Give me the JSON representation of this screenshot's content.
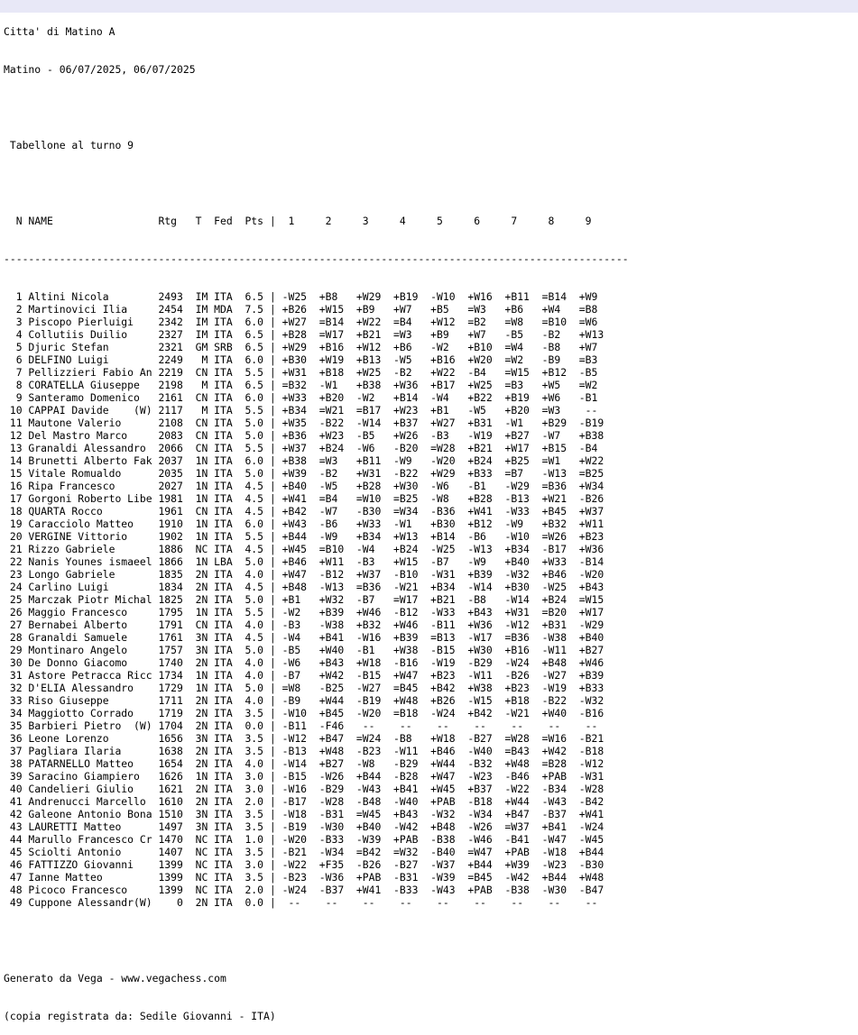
{
  "header": {
    "title": "Citta' di Matino A",
    "subtitle": "Matino - 06/07/2025, 06/07/2025",
    "board_title": " Tabellone al turno 9"
  },
  "table": {
    "columns_line": "  N NAME                 Rtg   T  Fed  Pts |  1     2     3     4     5     6     7     8     9",
    "separator_line": "-----------------------------------------------------------------------------------------------------",
    "rows": [
      "  1 Altini Nicola        2493  IM ITA  6.5 | -W25  +B8   +W29  +B19  -W10  +W16  +B11  =B14  +W9",
      "  2 Martinovici Ilia     2454  IM MDA  7.5 | +B26  +W15  +B9   +W7   +B5   =W3   +B6   +W4   =B8",
      "  3 Piscopo Pierluigi    2342  IM ITA  6.0 | +W27  =B14  +W22  =B4   +W12  =B2   =W8   =B10  =W6",
      "  4 Collutiis Duilio     2327  IM ITA  6.5 | +B28  =W17  +B21  =W3   +B9   +W7   -B5   -B2   +W13",
      "  5 Djuric Stefan        2321  GM SRB  6.5 | +W29  +B16  +W12  +B6   -W2   +B10  =W4   -B8   +W7",
      "  6 DELFINO Luigi        2249   M ITA  6.0 | +B30  +W19  +B13  -W5   +B16  +W20  =W2   -B9   =B3",
      "  7 Pellizzieri Fabio An 2219  CN ITA  5.5 | +W31  +B18  +W25  -B2   +W22  -B4   =W15  +B12  -B5",
      "  8 CORATELLA Giuseppe   2198   M ITA  6.5 | =B32  -W1   +B38  +W36  +B17  +W25  =B3   +W5   =W2",
      "  9 Santeramo Domenico   2161  CN ITA  6.0 | +W33  +B20  -W2   +B14  -W4   +B22  +B19  +W6   -B1",
      " 10 CAPPAI Davide    (W) 2117   M ITA  5.5 | +B34  =W21  =B17  +W23  +B1   -W5   +B20  =W3    --",
      " 11 Mautone Valerio      2108  CN ITA  5.0 | +W35  -B22  -W14  +B37  +W27  +B31  -W1   +B29  -B19",
      " 12 Del Mastro Marco     2083  CN ITA  5.0 | +B36  +W23  -B5   +W26  -B3   -W19  +B27  -W7   +B38",
      " 13 Granaldi Alessandro  2066  CN ITA  5.5 | +W37  +B24  -W6   -B20  =W28  +B21  +W17  +B15  -B4",
      " 14 Brunetti Alberto Fak 2037  1N ITA  6.0 | +B38  =W3   +B11  -W9   -W20  +B24  +B25  =W1   +W22",
      " 15 Vitale Romualdo      2035  1N ITA  5.0 | +W39  -B2   +W31  -B22  +W29  +B33  =B7   -W13  =B25",
      " 16 Ripa Francesco       2027  1N ITA  4.5 | +B40  -W5   +B28  +W30  -W6   -B1   -W29  =B36  +W34",
      " 17 Gorgoni Roberto Libe 1981  1N ITA  4.5 | +W41  =B4   =W10  =B25  -W8   +B28  -B13  +W21  -B26",
      " 18 QUARTA Rocco         1961  CN ITA  4.5 | +B42  -W7   -B30  =W34  -B36  +W41  -W33  +B45  +W37",
      " 19 Caracciolo Matteo    1910  1N ITA  6.0 | +W43  -B6   +W33  -W1   +B30  +B12  -W9   +B32  +W11",
      " 20 VERGINE Vittorio     1902  1N ITA  5.5 | +B44  -W9   +B34  +W13  +B14  -B6   -W10  =W26  +B23",
      " 21 Rizzo Gabriele       1886  NC ITA  4.5 | +W45  =B10  -W4   +B24  -W25  -W13  +B34  -B17  +W36",
      " 22 Nanis Younes ismaeel 1866  1N LBA  5.0 | +B46  +W11  -B3   +W15  -B7   -W9   +B40  +W33  -B14",
      " 23 Longo Gabriele       1835  2N ITA  4.0 | +W47  -B12  +W37  -B10  -W31  +B39  -W32  +B46  -W20",
      " 24 Carlino Luigi        1834  2N ITA  4.5 | +B48  -W13  =B36  -W21  +B34  -W14  +B30  -W25  +B43",
      " 25 Marczak Piotr Michal 1825  2N ITA  5.0 | +B1   +W32  -B7   =W17  +B21  -B8   -W14  +B24  =W15",
      " 26 Maggio Francesco     1795  1N ITA  5.5 | -W2   +B39  +W46  -B12  -W33  +B43  +W31  =B20  +W17",
      " 27 Bernabei Alberto     1791  CN ITA  4.0 | -B3   -W38  +B32  +W46  -B11  +W36  -W12  +B31  -W29",
      " 28 Granaldi Samuele     1761  3N ITA  4.5 | -W4   +B41  -W16  +B39  =B13  -W17  =B36  -W38  +B40",
      " 29 Montinaro Angelo     1757  3N ITA  5.0 | -B5   +W40  -B1   +W38  -B15  +W30  +B16  -W11  +B27",
      " 30 De Donno Giacomo     1740  2N ITA  4.0 | -W6   +B43  +W18  -B16  -W19  -B29  -W24  +B48  +W46",
      " 31 Astore Petracca Ricc 1734  1N ITA  4.0 | -B7   +W42  -B15  +W47  +B23  -W11  -B26  -W27  +B39",
      " 32 D'ELIA Alessandro    1729  1N ITA  5.0 | =W8   -B25  -W27  =B45  +B42  +W38  +B23  -W19  +B33",
      " 33 Riso Giuseppe        1711  2N ITA  4.0 | -B9   +W44  -B19  +W48  +B26  -W15  +B18  -B22  -W32",
      " 34 Maggiotto Corrado    1719  2N ITA  3.5 | -W10  +B45  -W20  =B18  -W24  +B42  -W21  +W40  -B16",
      " 35 Barbieri Pietro  (W) 1704  2N ITA  0.0 | -B11  -F46   --    --    --    --    --    --    --",
      " 36 Leone Lorenzo        1656  3N ITA  3.5 | -W12  +B47  =W24  -B8   +W18  -B27  =W28  =W16  -B21",
      " 37 Pagliara Ilaria      1638  2N ITA  3.5 | -B13  +W48  -B23  -W11  +B46  -W40  =B43  +W42  -B18",
      " 38 PATARNELLO Matteo    1654  2N ITA  4.0 | -W14  +B27  -W8   -B29  +W44  -B32  +W48  =B28  -W12",
      " 39 Saracino Giampiero   1626  1N ITA  3.0 | -B15  -W26  +B44  -B28  +W47  -W23  -B46  +PAB  -W31",
      " 40 Candelieri Giulio    1621  2N ITA  3.0 | -W16  -B29  -W43  +B41  +W45  +B37  -W22  -B34  -W28",
      " 41 Andrenucci Marcello  1610  2N ITA  2.0 | -B17  -W28  -B48  -W40  +PAB  -B18  +W44  -W43  -B42",
      " 42 Galeone Antonio Bona 1510  3N ITA  3.5 | -W18  -B31  =W45  +B43  -W32  -W34  +B47  -B37  +W41",
      " 43 LAURETTI Matteo      1497  3N ITA  3.5 | -B19  -W30  +B40  -W42  +B48  -W26  =W37  +B41  -W24",
      " 44 Marullo Francesco Cr 1470  NC ITA  1.0 | -W20  -B33  -W39  +PAB  -B38  -W46  -B41  -W47  -W45",
      " 45 Sciolti Antonio      1407  NC ITA  3.5 | -B21  -W34  =B42  =W32  -B40  =W47  +PAB  -W18  +B44",
      " 46 FATTIZZO Giovanni    1399  NC ITA  3.0 | -W22  +F35  -B26  -B27  -W37  +B44  +W39  -W23  -B30",
      " 47 Ianne Matteo         1399  NC ITA  3.5 | -B23  -W36  +PAB  -B31  -W39  =B45  -W42  +B44  +W48",
      " 48 Picoco Francesco     1399  NC ITA  2.0 | -W24  -B37  +W41  -B33  -W43  +PAB  -B38  -W30  -B47",
      " 49 Cuppone Alessandr(W)    0  2N ITA  0.0 |  --    --    --    --    --    --    --    --    --"
    ]
  },
  "footer": {
    "generated_by": "Generato da Vega - www.vegachess.com",
    "registered_copy": "(copia registrata da: Sedile Giovanni - ITA)"
  },
  "colors": {
    "title_bar_bg": "#e8e8f7",
    "text": "#000000",
    "background": "#ffffff"
  }
}
